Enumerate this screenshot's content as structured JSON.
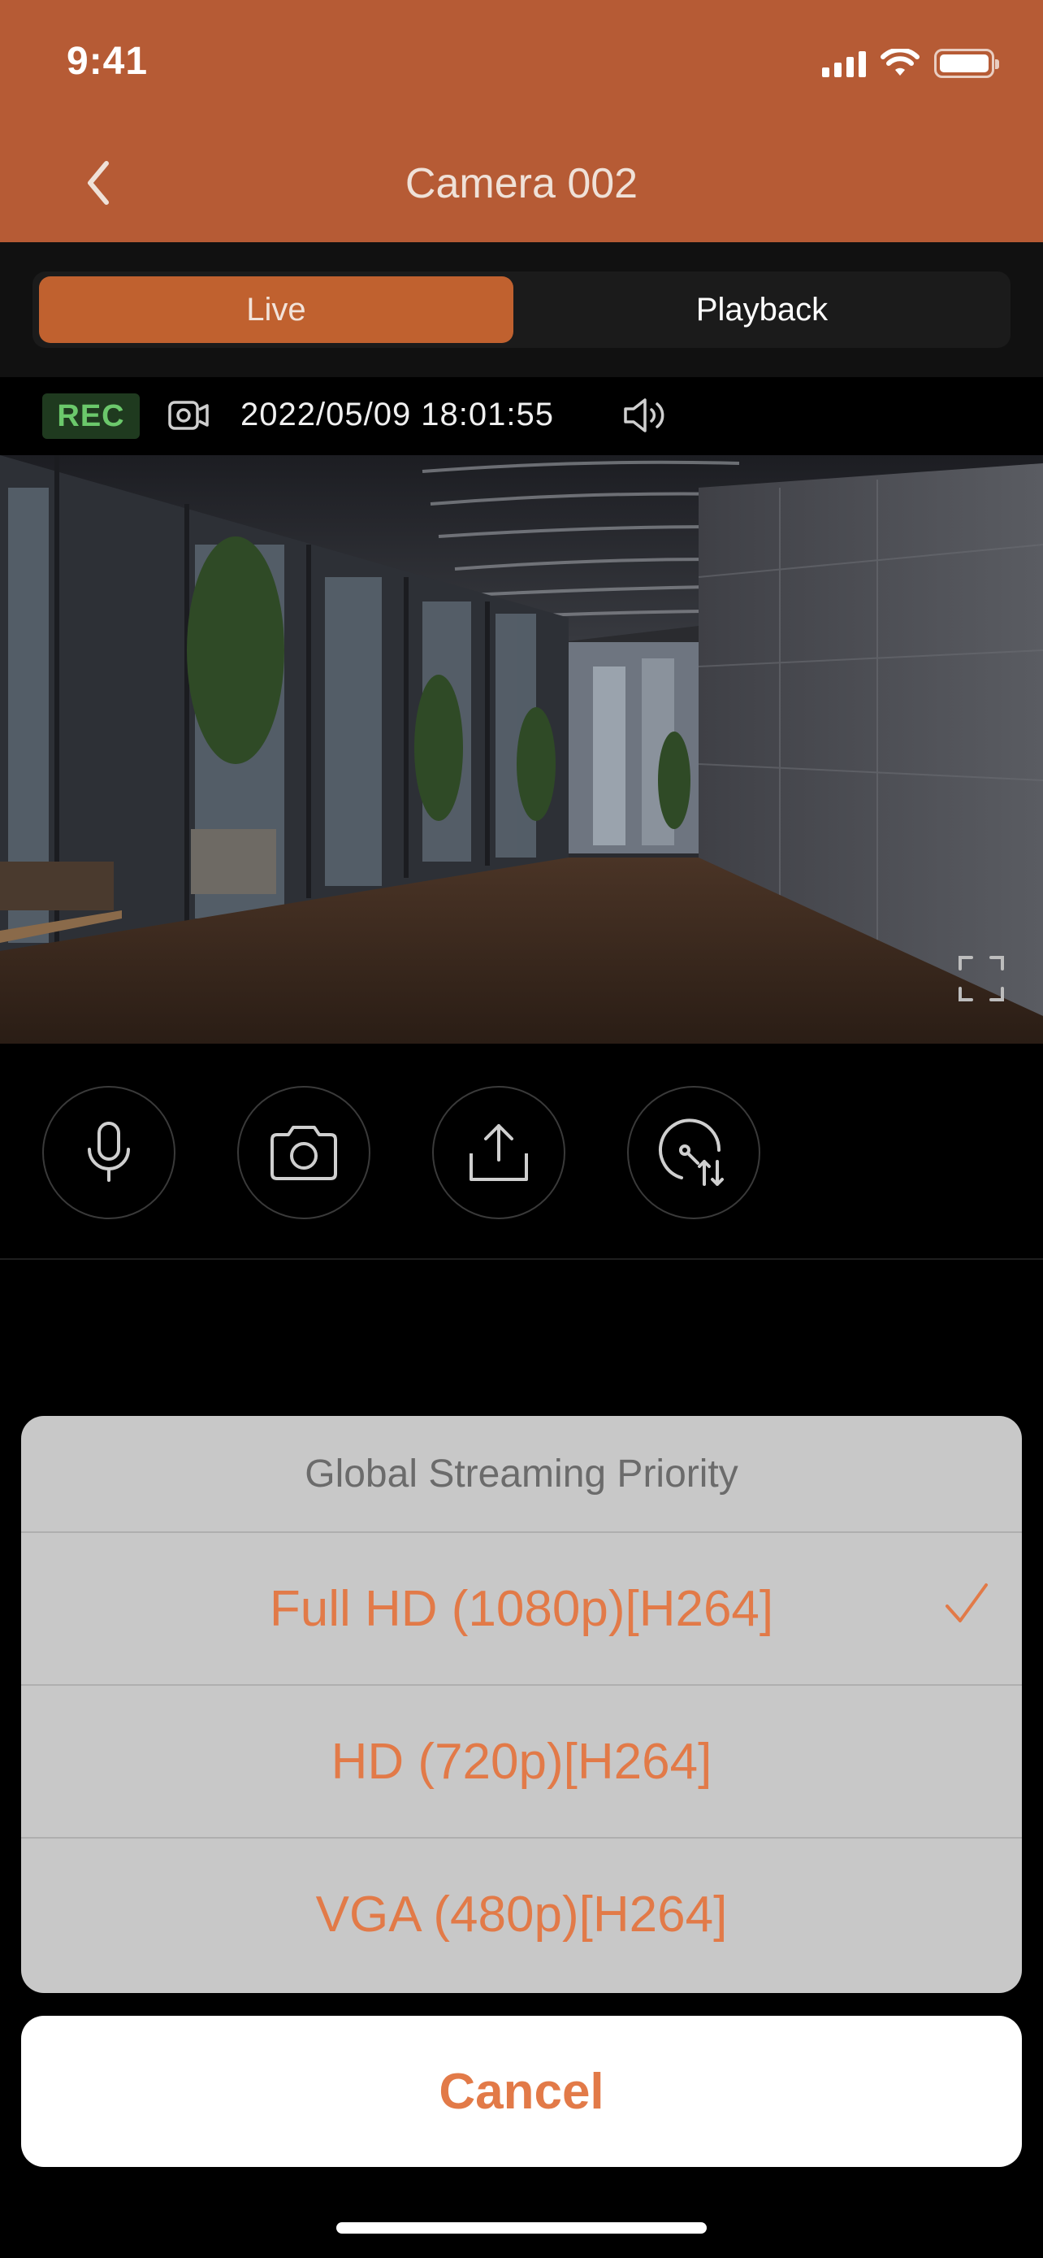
{
  "status_bar": {
    "time": "9:41"
  },
  "nav": {
    "title": "Camera 002"
  },
  "tabs": {
    "live": "Live",
    "playback": "Playback",
    "active": "Live"
  },
  "info": {
    "rec": "REC",
    "timestamp": "2022/05/09 18:01:55"
  },
  "colors": {
    "header": "#B65B35",
    "accent": "#E27A48",
    "rec_green": "#6BC86B"
  },
  "controls": [
    {
      "icon": "microphone-icon"
    },
    {
      "icon": "camera-snapshot-icon"
    },
    {
      "icon": "share-icon"
    },
    {
      "icon": "ptz-speed-icon"
    }
  ],
  "sheet": {
    "title": "Global Streaming Priority",
    "options": [
      {
        "label": "Full HD (1080p)[H264]",
        "selected": true
      },
      {
        "label": "HD (720p)[H264]",
        "selected": false
      },
      {
        "label": "VGA (480p)[H264]",
        "selected": false
      }
    ],
    "cancel": "Cancel"
  }
}
